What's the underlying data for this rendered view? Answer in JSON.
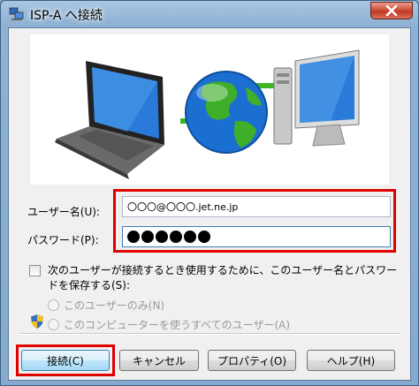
{
  "window": {
    "title": "ISP-A へ接続"
  },
  "form": {
    "username_label": "ユーザー名(U):",
    "username_value": "〇〇〇@〇〇〇.jet.ne.jp",
    "password_label": "パスワード(P):",
    "password_dots": 6,
    "save_checkbox_label": "次のユーザーが接続するとき使用するために、このユーザー名とパスワードを保存する(S):",
    "save_checked": false,
    "radio_me_only": "このユーザーのみ(N)",
    "radio_all_users": "このコンピューターを使うすべてのユーザー(A)"
  },
  "buttons": {
    "connect": "接続(C)",
    "cancel": "キャンセル",
    "properties": "プロパティ(O)",
    "help": "ヘルプ(H)"
  },
  "colors": {
    "highlight": "#e00000",
    "link_line": "#3cb522"
  }
}
